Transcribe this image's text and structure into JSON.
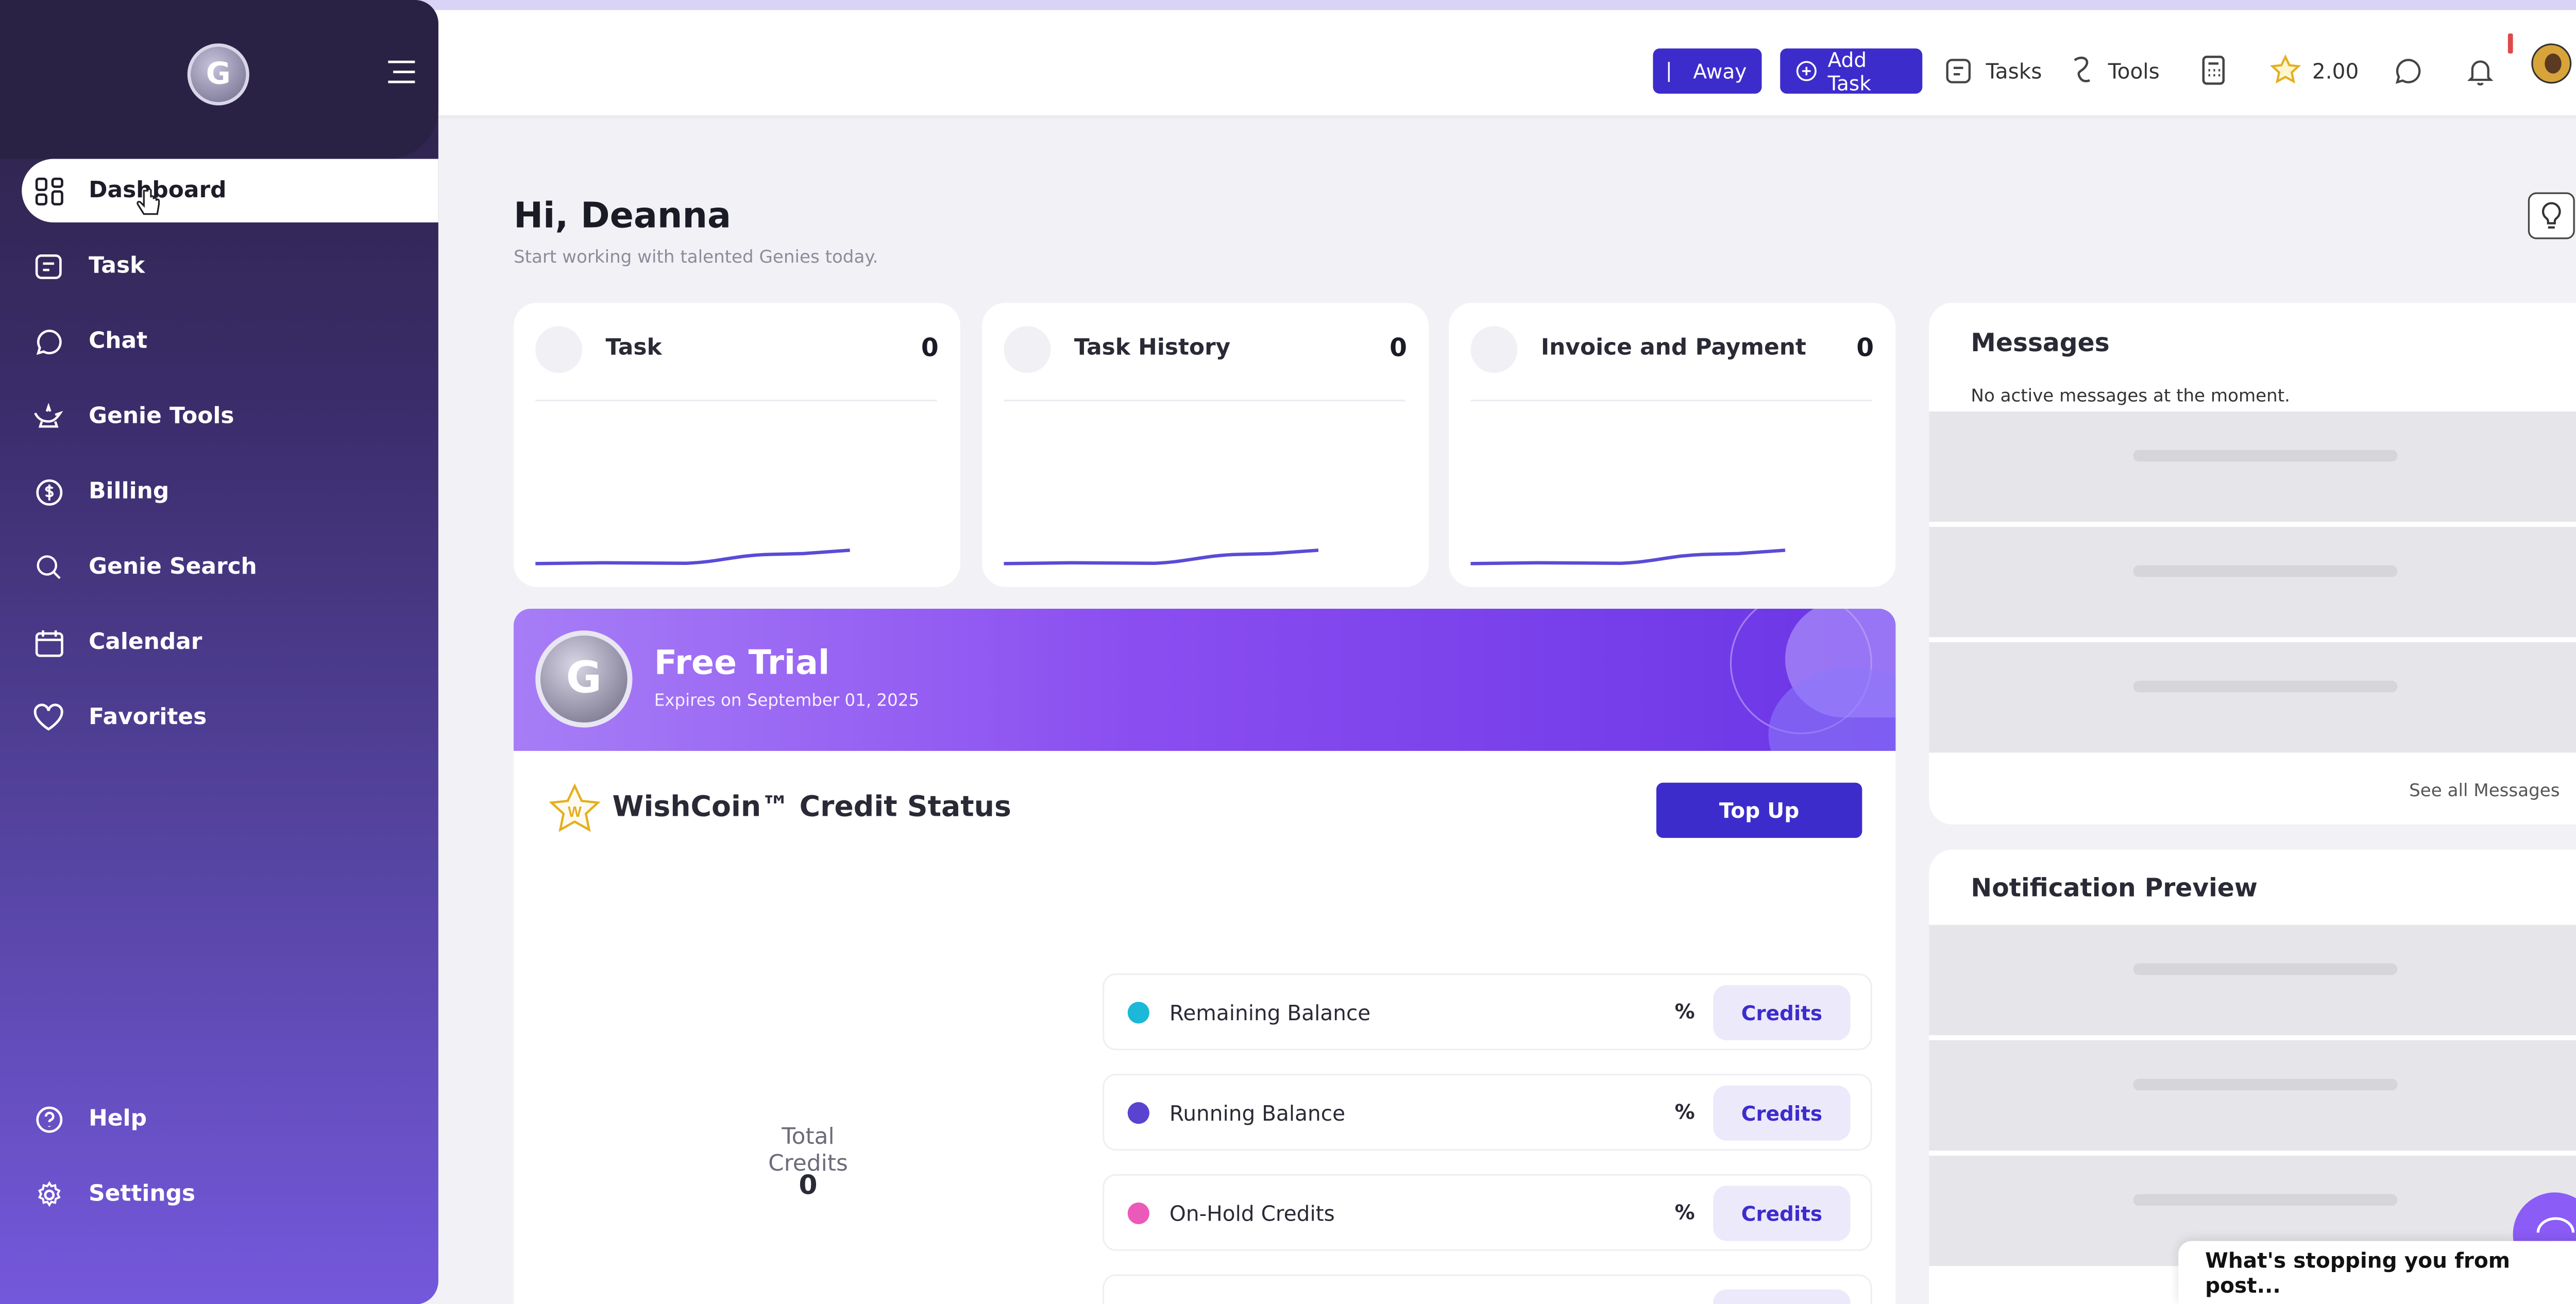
{
  "header": {
    "away_label": "Away",
    "add_task_label": "Add Task",
    "tasks_label": "Tasks",
    "tools_label": "Tools",
    "wishcoin_balance": "2.00"
  },
  "sidebar": {
    "items": [
      {
        "label": "Dashboard",
        "icon": "grid-icon",
        "active": true
      },
      {
        "label": "Task",
        "icon": "task-icon"
      },
      {
        "label": "Chat",
        "icon": "chat-icon"
      },
      {
        "label": "Genie Tools",
        "icon": "lamp-icon"
      },
      {
        "label": "Billing",
        "icon": "dollar-icon"
      },
      {
        "label": "Genie Search",
        "icon": "search-icon"
      },
      {
        "label": "Calendar",
        "icon": "calendar-icon"
      },
      {
        "label": "Favorites",
        "icon": "heart-icon"
      }
    ],
    "bottom_items": [
      {
        "label": "Help",
        "icon": "help-icon"
      },
      {
        "label": "Settings",
        "icon": "gear-icon"
      }
    ]
  },
  "main": {
    "greeting": "Hi, Deanna",
    "subtitle": "Start working with talented Genies today.",
    "stats": [
      {
        "title": "Task",
        "value": "0"
      },
      {
        "title": "Task History",
        "value": "0"
      },
      {
        "title": "Invoice and Payment",
        "value": "0"
      }
    ],
    "banner": {
      "title": "Free Trial",
      "subtitle": "Expires on September 01, 2025"
    },
    "credit": {
      "title": "WishCoin™ Credit Status",
      "topup_label": "Top Up",
      "total_label": "Total Credits",
      "total_value": "0",
      "rows": [
        {
          "label": "Remaining Balance",
          "pct": "%",
          "button": "Credits",
          "color": "#1cb8d8"
        },
        {
          "label": "Running Balance",
          "pct": "%",
          "button": "Credits",
          "color": "#5a44cf"
        },
        {
          "label": "On-Hold Credits",
          "pct": "%",
          "button": "Credits",
          "color": "#ec5ab9"
        }
      ]
    }
  },
  "right": {
    "messages_title": "Messages",
    "messages_empty": "No active messages at the moment.",
    "see_all": "See all Messages",
    "notification_title": "Notification Preview"
  },
  "prompt": {
    "text": "What's stopping you from post..."
  },
  "colors": {
    "accent": "#3d2ccc",
    "sidebar_top": "#2b2344",
    "sidebar_bottom": "#7458dc",
    "banner": "#8a4ef0"
  }
}
